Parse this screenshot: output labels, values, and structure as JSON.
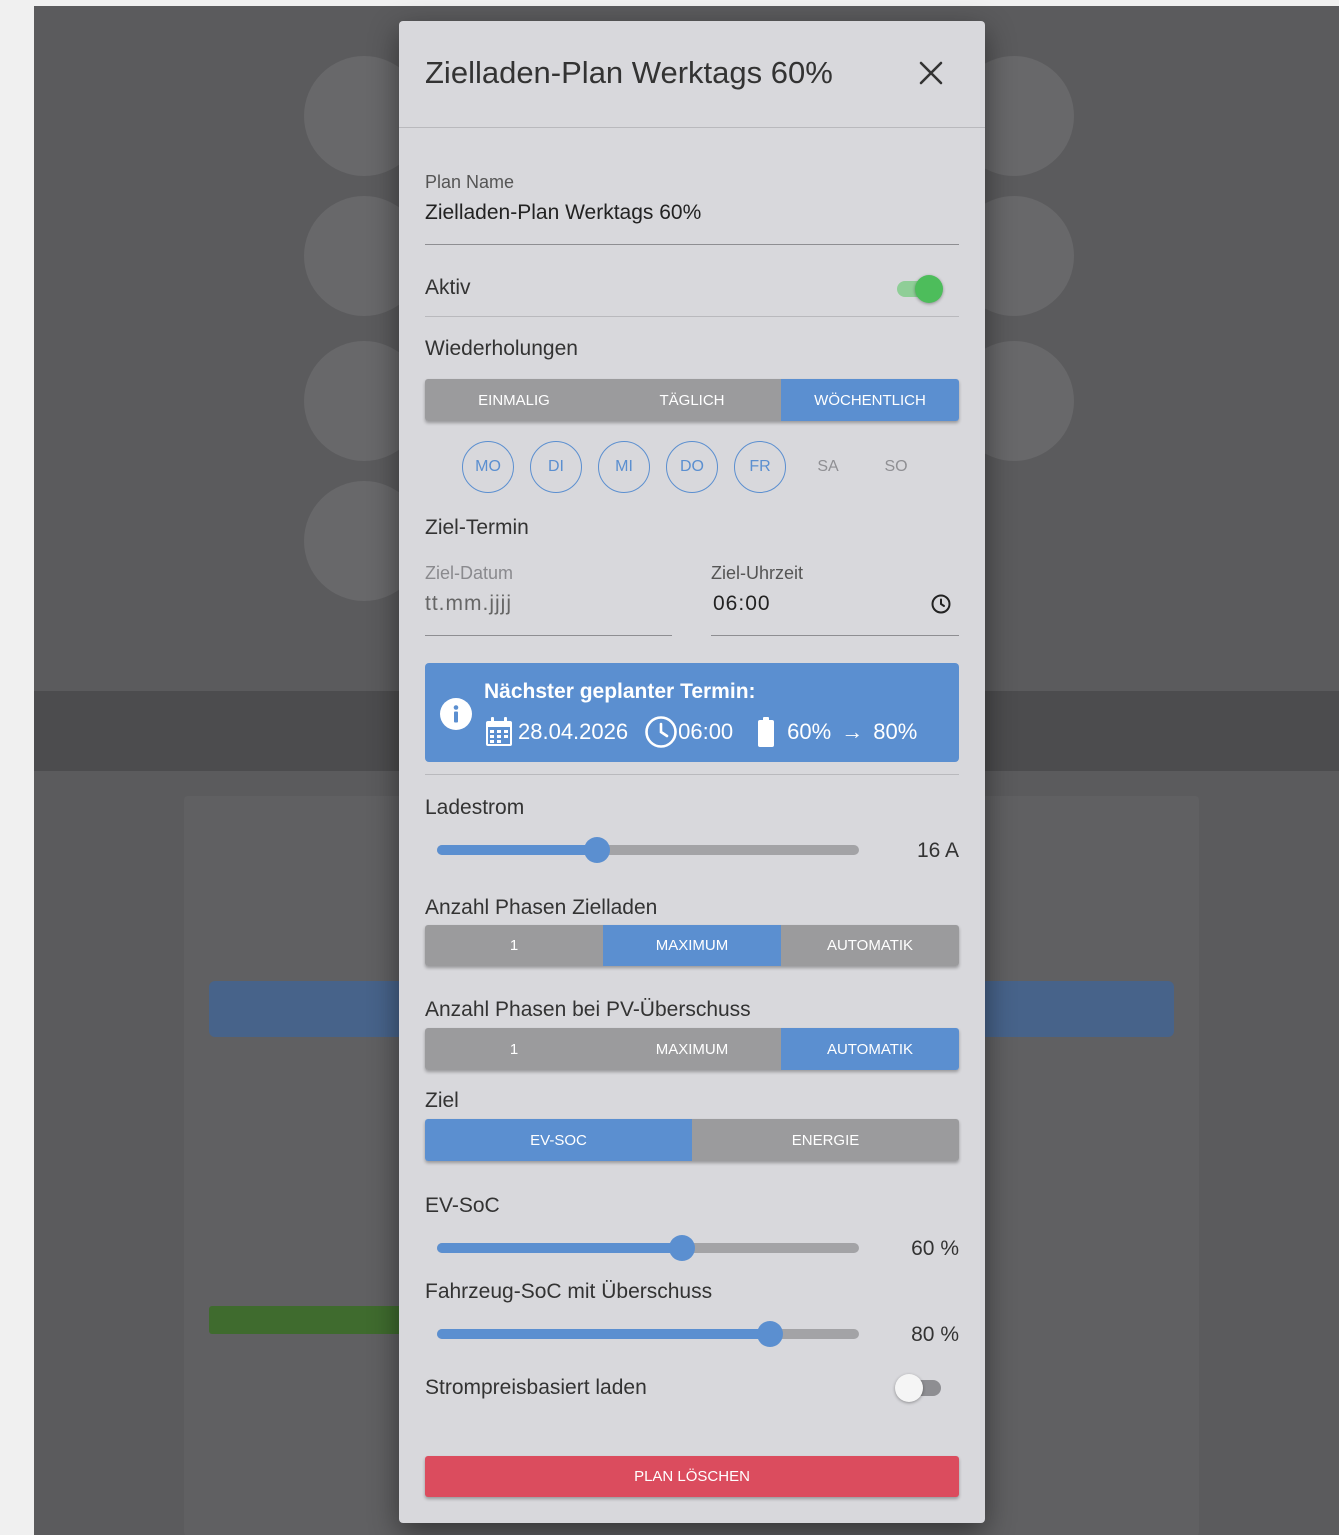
{
  "dialog": {
    "title": "Zielladen-Plan Werktags 60%",
    "plan_name_label": "Plan Name",
    "plan_name_value": "Zielladen-Plan Werktags 60%",
    "aktiv_label": "Aktiv",
    "aktiv_on": true,
    "repeat_title": "Wiederholungen",
    "repeat_options": [
      "EINMALIG",
      "TÄGLICH",
      "WÖCHENTLICH"
    ],
    "repeat_selected": "WÖCHENTLICH",
    "days": [
      {
        "label": "MO",
        "on": true
      },
      {
        "label": "DI",
        "on": true
      },
      {
        "label": "MI",
        "on": true
      },
      {
        "label": "DO",
        "on": true
      },
      {
        "label": "FR",
        "on": true
      },
      {
        "label": "SA",
        "on": false
      },
      {
        "label": "SO",
        "on": false
      }
    ],
    "target_title": "Ziel-Termin",
    "date_label": "Ziel-Datum",
    "date_placeholder": "tt.mm.jjjj",
    "time_label": "Ziel-Uhrzeit",
    "time_value": "06:00",
    "info": {
      "title": "Nächster geplanter Termin:",
      "date": "28.04.2026",
      "time": "06:00",
      "soc_from": "60%",
      "arrow": "→",
      "soc_to": "80%"
    },
    "ladestrom": {
      "label": "Ladestrom",
      "value": 16,
      "display": "16 A",
      "fraction": 0.38
    },
    "phases_target": {
      "label": "Anzahl Phasen Zielladen",
      "options": [
        "1",
        "MAXIMUM",
        "AUTOMATIK"
      ],
      "selected": "MAXIMUM"
    },
    "phases_pv": {
      "label": "Anzahl Phasen bei PV-Überschuss",
      "options": [
        "1",
        "MAXIMUM",
        "AUTOMATIK"
      ],
      "selected": "AUTOMATIK"
    },
    "ziel": {
      "label": "Ziel",
      "options": [
        "EV-SOC",
        "ENERGIE"
      ],
      "selected": "EV-SOC"
    },
    "ev_soc": {
      "label": "EV-SoC",
      "value": 60,
      "display": "60 %",
      "fraction": 0.58
    },
    "vehicle_soc": {
      "label": "Fahrzeug-SoC mit Überschuss",
      "value": 80,
      "display": "80 %",
      "fraction": 0.79
    },
    "price_based": {
      "label": "Strompreisbasiert laden",
      "on": false
    },
    "delete_label": "PLAN LÖSCHEN"
  },
  "colors": {
    "accent": "#5b8fd0",
    "switch_on_track": "#8fce97",
    "switch_on_knob": "#4dbd5b",
    "switch_off_track": "#8e8e92",
    "switch_off_knob": "#f5f5f5",
    "danger": "#db4c5e"
  }
}
